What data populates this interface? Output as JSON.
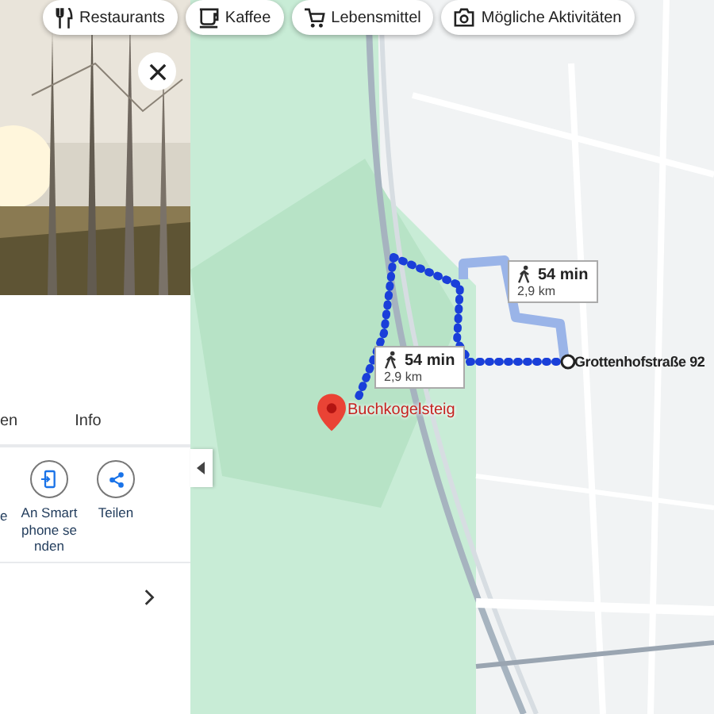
{
  "chips": [
    {
      "label": "Restaurants",
      "kind": "fork"
    },
    {
      "label": "Kaffee",
      "kind": "cup"
    },
    {
      "label": "Lebensmittel",
      "kind": "cart"
    },
    {
      "label": "Mögliche Aktivitäten",
      "kind": "camera"
    }
  ],
  "panel": {
    "photo": {
      "kind": "picture"
    },
    "tabs": [
      "en",
      "Info"
    ],
    "actions": [
      {
        "label": "e",
        "kind": "none"
      },
      {
        "label": "An Smartphone senden",
        "kind": "phone"
      },
      {
        "label": "Teilen",
        "kind": "share"
      }
    ]
  },
  "map": {
    "place": "Buchkogelsteig",
    "destination": "Grottenhofstraße 92",
    "routes": [
      {
        "time": "54 min",
        "distance": "2,9 km"
      },
      {
        "time": "54 min",
        "distance": "2,9 km"
      }
    ]
  }
}
